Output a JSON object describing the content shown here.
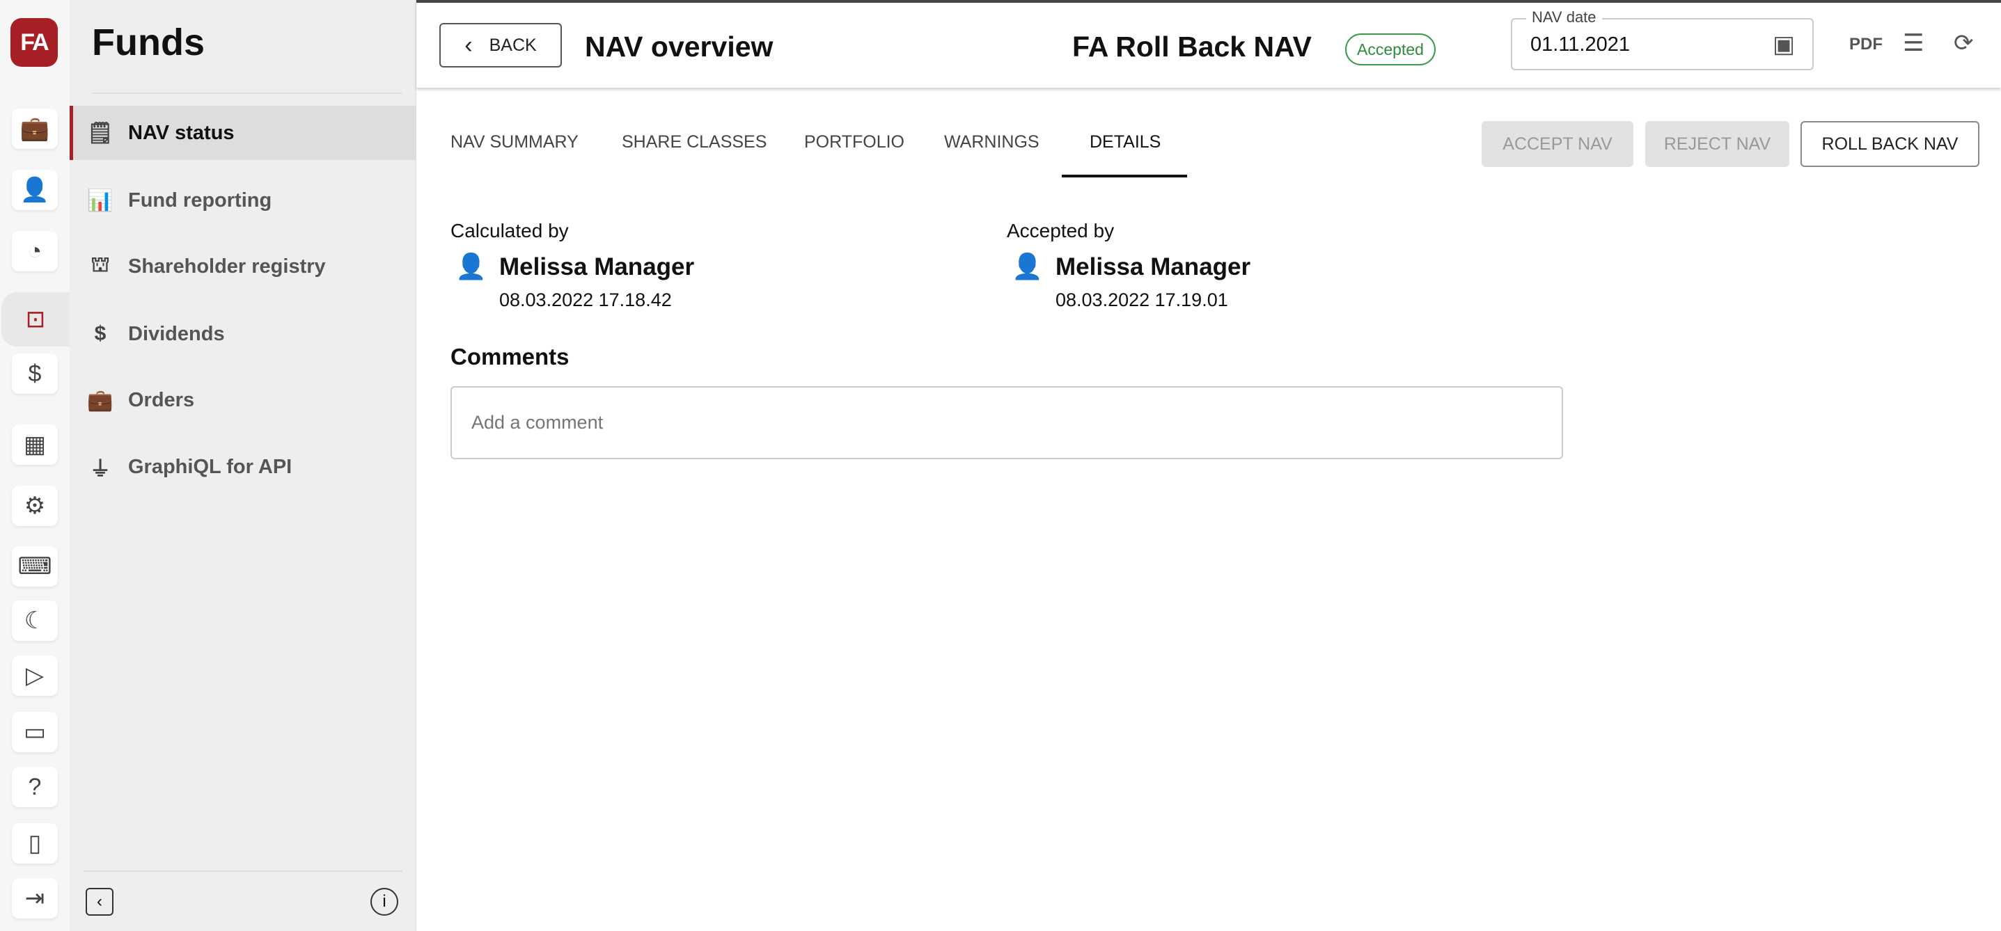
{
  "app": {
    "logo": "FA",
    "section_title": "Funds",
    "accent": "#a51f24"
  },
  "rail": {
    "items": [
      "portfolio-icon",
      "client-money-icon",
      "reports-chart-icon",
      "funds-icon",
      "dividends-icon",
      "building-icon",
      "settings-doc-icon",
      "code-laptop-icon",
      "moon-icon",
      "play-icon",
      "ticket-icon",
      "help-icon",
      "mobile-login-icon",
      "logout-icon"
    ]
  },
  "sidebar": {
    "items": [
      {
        "label": "NAV status",
        "icon": "nav-status-icon",
        "active": true
      },
      {
        "label": "Fund reporting",
        "icon": "bar-chart-icon"
      },
      {
        "label": "Shareholder registry",
        "icon": "shareholders-icon"
      },
      {
        "label": "Dividends",
        "icon": "dividends-icon"
      },
      {
        "label": "Orders",
        "icon": "briefcase-icon"
      },
      {
        "label": "GraphiQL for API",
        "icon": "plug-icon"
      }
    ]
  },
  "header": {
    "back": "BACK",
    "title": "NAV overview",
    "fund": "FA Roll Back NAV",
    "status": "Accepted",
    "status_color": "#2e8b3e",
    "nav_date_label": "NAV date",
    "nav_date": "01.11.2021"
  },
  "tabs": [
    "NAV SUMMARY",
    "SHARE CLASSES",
    "PORTFOLIO",
    "WARNINGS",
    "DETAILS"
  ],
  "active_tab": "DETAILS",
  "actions": {
    "accept": "ACCEPT NAV",
    "reject": "REJECT NAV",
    "rollback": "ROLL BACK NAV"
  },
  "details": {
    "calculated_label": "Calculated by",
    "calculated_name": "Melissa Manager",
    "calculated_ts": "08.03.2022 17.18.42",
    "accepted_label": "Accepted by",
    "accepted_name": "Melissa Manager",
    "accepted_ts": "08.03.2022 17.19.01",
    "comments_label": "Comments",
    "comment_placeholder": "Add a comment"
  }
}
